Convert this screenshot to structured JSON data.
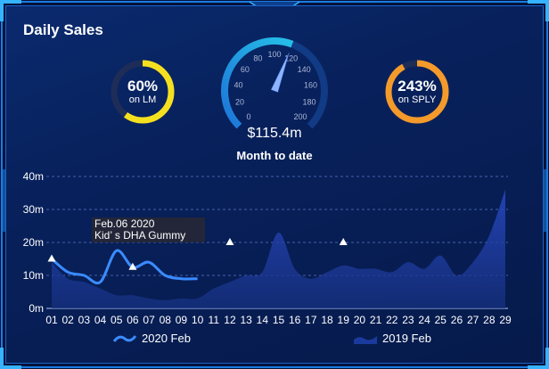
{
  "header": {
    "title": "Daily Sales"
  },
  "kpis": {
    "left": {
      "value": "60%",
      "label": "on LM",
      "fraction": 0.6,
      "color": "#f5e020"
    },
    "right": {
      "value": "243%",
      "label": "on SPLY",
      "fraction": 0.92,
      "color": "#f39a2b"
    }
  },
  "gauge": {
    "value_text": "$115.4m",
    "label": "Month to date",
    "value": 115.4,
    "min": 0,
    "max": 200,
    "ticks": [
      "0",
      "20",
      "40",
      "60",
      "80",
      "100",
      "120",
      "140",
      "160",
      "180",
      "200"
    ]
  },
  "tooltip": {
    "line1": "Feb.06 2020",
    "line2": "Kid’ s DHA Gummy"
  },
  "legend": {
    "series1": "2020 Feb",
    "series2": "2019 Feb"
  },
  "colors": {
    "line_2020": "#3b8bff",
    "area_2019": "#1b3a9e",
    "grid": "#5a7ac8",
    "text": "#ffffff",
    "panel_border": "#1d63c9"
  },
  "chart_data": {
    "type": "line",
    "x": [
      "01",
      "02",
      "03",
      "04",
      "05",
      "06",
      "07",
      "08",
      "09",
      "10",
      "11",
      "12",
      "13",
      "14",
      "15",
      "16",
      "17",
      "18",
      "19",
      "20",
      "21",
      "22",
      "23",
      "24",
      "25",
      "26",
      "27",
      "28",
      "29"
    ],
    "y_ticks": [
      "0m",
      "10m",
      "20m",
      "30m",
      "40m"
    ],
    "ylim": [
      0,
      40
    ],
    "grid": true,
    "legend_position": "bottom",
    "series": [
      {
        "name": "2020 Feb",
        "type": "line",
        "values": [
          15,
          11,
          10,
          8,
          17.5,
          12.5,
          14,
          10,
          9,
          9
        ]
      },
      {
        "name": "2019 Feb",
        "type": "area",
        "values": [
          14,
          9,
          8,
          6,
          4,
          4,
          3,
          2.5,
          3,
          3,
          6,
          8,
          10,
          11,
          23,
          12,
          9,
          11,
          13,
          12,
          12,
          11,
          14,
          12,
          16,
          10,
          14,
          22,
          36
        ]
      }
    ],
    "markers": [
      {
        "x": "01",
        "y": 15
      },
      {
        "x": "06",
        "y": 12.5
      },
      {
        "x": "12",
        "y": 20
      },
      {
        "x": "19",
        "y": 20
      }
    ]
  }
}
